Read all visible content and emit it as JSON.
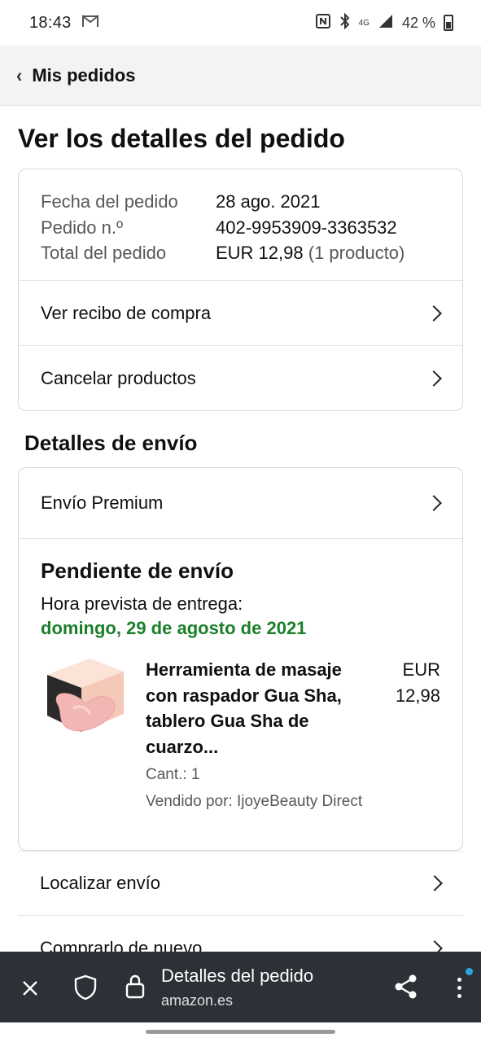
{
  "status_bar": {
    "time": "18:43",
    "battery": "42 %",
    "network": "4G"
  },
  "header": {
    "back_label": "Mis pedidos"
  },
  "page_title": "Ver los detalles del pedido",
  "summary": {
    "rows": [
      {
        "label": "Fecha del pedido",
        "value": "28 ago. 2021",
        "extra": ""
      },
      {
        "label": "Pedido n.º",
        "value": "402-9953909-3363532",
        "extra": ""
      },
      {
        "label": "Total del pedido",
        "value": "EUR 12,98",
        "extra": "(1 producto)"
      }
    ],
    "links": [
      "Ver recibo de compra",
      "Cancelar productos"
    ]
  },
  "shipping": {
    "section_title": "Detalles de envío",
    "method": "Envío Premium",
    "status": "Pendiente de envío",
    "eta_label": "Hora prevista de entrega:",
    "eta_date": "domingo, 29 de agosto de 2021",
    "item": {
      "title": "Herramienta de masaje con raspador Gua Sha, tablero Gua Sha de cuarzo...",
      "qty": "Cant.: 1",
      "seller": "Vendido por: IjoyeBeauty Direct",
      "price": "EUR 12,98"
    }
  },
  "actions": [
    "Localizar envío",
    "Comprarlo de nuevo"
  ],
  "browser": {
    "title": "Detalles del pedido",
    "url": "amazon.es"
  },
  "colors": {
    "eta_green": "#1b7f2a",
    "browser_bar": "#2b3137",
    "notification_dot": "#29a8e0"
  }
}
